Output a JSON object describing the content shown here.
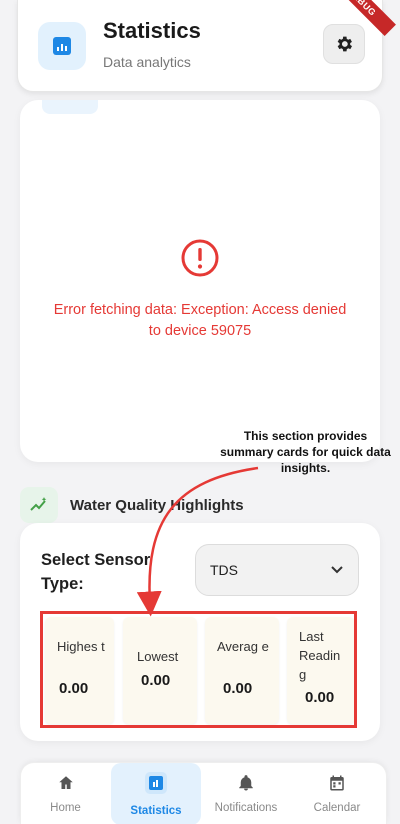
{
  "header": {
    "title": "Statistics",
    "subtitle": "Data analytics",
    "debug_banner": "DEBUG"
  },
  "error": {
    "message": "Error fetching data: Exception: Access denied to device 59075"
  },
  "annotation": {
    "text": "This section provides summary cards for quick data insights."
  },
  "highlights": {
    "title": "Water Quality Highlights",
    "sensor_label": "Select Sensor Type:",
    "sensor_value": "TDS",
    "cards": [
      {
        "label": "Highes t",
        "value": "0.00"
      },
      {
        "label": "Lowest",
        "value": "0.00"
      },
      {
        "label": "Averag e",
        "value": "0.00"
      },
      {
        "label": "Last Readin g",
        "value": "0.00"
      }
    ]
  },
  "nav": {
    "items": [
      {
        "label": "Home",
        "icon": "home-icon"
      },
      {
        "label": "Statistics",
        "icon": "statistics-icon",
        "active": true
      },
      {
        "label": "Notifications",
        "icon": "bell-icon"
      },
      {
        "label": "Calendar",
        "icon": "calendar-icon"
      }
    ]
  },
  "colors": {
    "accent": "#1e88e5",
    "error": "#e53935",
    "card_bg": "#fcf9ef"
  }
}
